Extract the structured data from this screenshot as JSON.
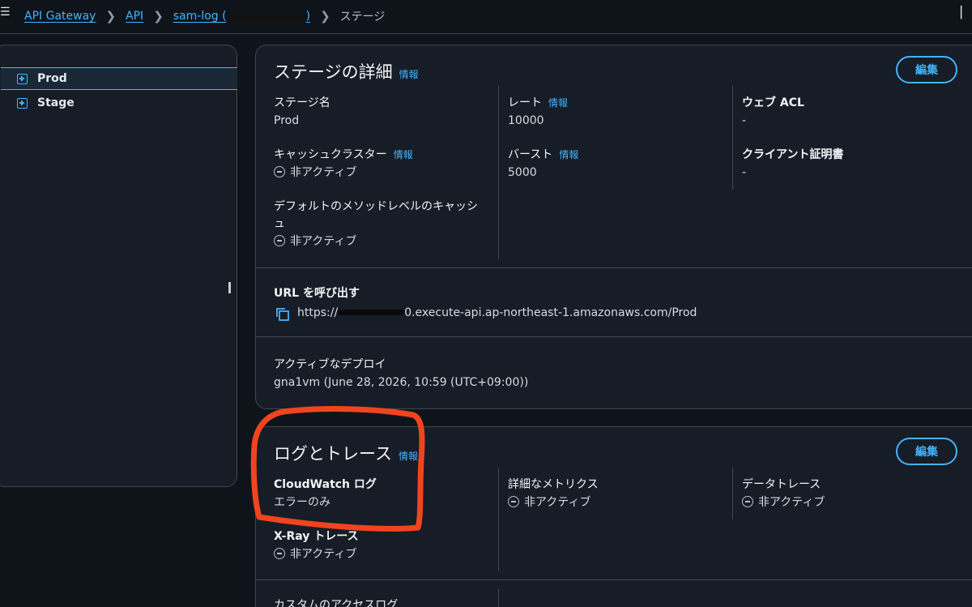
{
  "breadcrumb": {
    "items": [
      "API Gateway",
      "API",
      "sam-log ("
    ],
    "redacted_tail": ")",
    "current": "ステージ"
  },
  "sidebar": {
    "items": [
      {
        "label": "Prod",
        "selected": true
      },
      {
        "label": "Stage",
        "selected": false
      }
    ]
  },
  "stage_details": {
    "title": "ステージの詳細",
    "info": "情報",
    "edit_label": "編集",
    "stage_name_label": "ステージ名",
    "stage_name_value": "Prod",
    "cache_cluster_label": "キャッシュクラスター",
    "cache_cluster_info": "情報",
    "cache_cluster_value": "非アクティブ",
    "default_method_cache_label_line1": "デフォルトのメソッドレベルのキャッシ",
    "default_method_cache_label_line2": "ュ",
    "default_method_cache_value": "非アクティブ",
    "rate_label": "レート",
    "rate_info": "情報",
    "rate_value": "10000",
    "burst_label": "バースト",
    "burst_info": "情報",
    "burst_value": "5000",
    "web_acl_label": "ウェブ ACL",
    "web_acl_value": "-",
    "client_cert_label": "クライアント証明書",
    "client_cert_value": "-",
    "invoke_url_label": "URL を呼び出す",
    "invoke_url_prefix": "https://",
    "invoke_url_suffix": "0.execute-api.ap-northeast-1.amazonaws.com/Prod",
    "active_deploy_label": "アクティブなデプロイ",
    "active_deploy_value": "gna1vm (June 28, 2026, 10:59 (UTC+09:00))"
  },
  "logs_traces": {
    "title": "ログとトレース",
    "info": "情報",
    "edit_label": "編集",
    "cloudwatch_label": "CloudWatch ログ",
    "cloudwatch_value": "エラーのみ",
    "detailed_metrics_label": "詳細なメトリクス",
    "detailed_metrics_value": "非アクティブ",
    "data_trace_label": "データトレース",
    "data_trace_value": "非アクティブ",
    "xray_label": "X-Ray トレース",
    "xray_value": "非アクティブ",
    "custom_access_log_label": "カスタムのアクセスログ"
  },
  "colors": {
    "background": "#0f141a",
    "panel": "#161d26",
    "accent": "#42b4ff",
    "highlight": "#f0441f"
  }
}
